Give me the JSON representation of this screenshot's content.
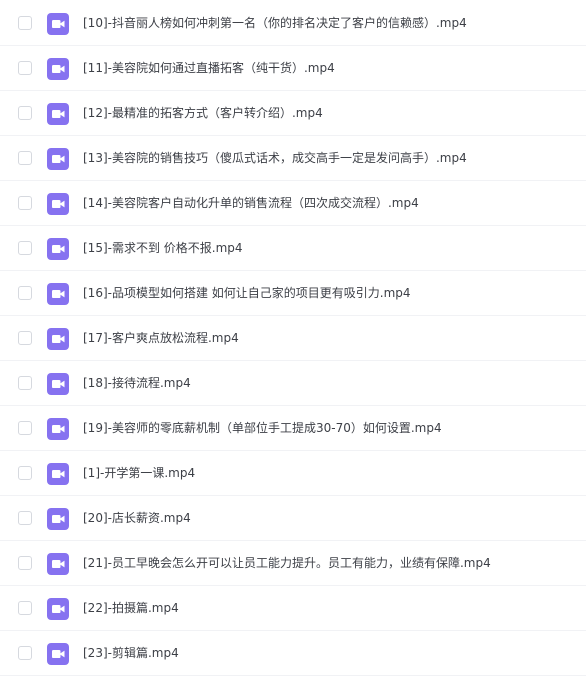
{
  "file_list": {
    "icon": "video-file-icon",
    "icon_color": "#8672f0",
    "items": [
      {
        "name": "[10]-抖音丽人榜如何冲刺第一名（你的排名决定了客户的信赖感）.mp4"
      },
      {
        "name": "[11]-美容院如何通过直播拓客（纯干货）.mp4"
      },
      {
        "name": "[12]-最精准的拓客方式（客户转介绍）.mp4"
      },
      {
        "name": "[13]-美容院的销售技巧（傻瓜式话术，成交高手一定是发问高手）.mp4"
      },
      {
        "name": "[14]-美容院客户自动化升单的销售流程（四次成交流程）.mp4"
      },
      {
        "name": "[15]-需求不到 价格不报.mp4"
      },
      {
        "name": "[16]-品项模型如何搭建 如何让自己家的项目更有吸引力.mp4"
      },
      {
        "name": "[17]-客户爽点放松流程.mp4"
      },
      {
        "name": "[18]-接待流程.mp4"
      },
      {
        "name": "[19]-美容师的零底薪机制（单部位手工提成30-70）如何设置.mp4"
      },
      {
        "name": "[1]-开学第一课.mp4"
      },
      {
        "name": "[20]-店长薪资.mp4"
      },
      {
        "name": "[21]-员工早晚会怎么开可以让员工能力提升。员工有能力，业绩有保障.mp4"
      },
      {
        "name": "[22]-拍摄篇.mp4"
      },
      {
        "name": "[23]-剪辑篇.mp4"
      }
    ]
  }
}
